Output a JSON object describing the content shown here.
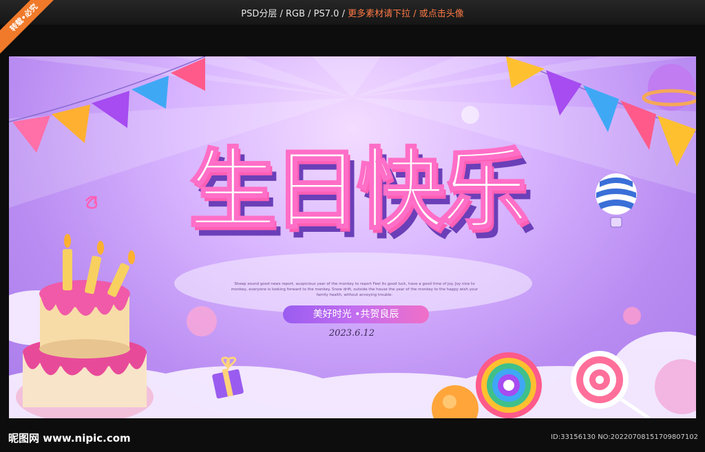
{
  "header": {
    "format_text": "PSD分层 / RGB / PS7.0 / ",
    "more_text": "更多素材请下拉 / 或点击头像"
  },
  "corner_badge": "转载•必究",
  "poster": {
    "title": "生日快乐",
    "blurb": "Sheep sound good news report, auspicious year of the monkey to report Feel its good luck, have a good time of joy. Joy nice to monkey, everyone is looking forward to the monkey. Snow drift, outside the house the year of the monkey to the happy wish your family health, without annoying trouble.",
    "slogan": "美好时光 •共贺良辰",
    "date": "2023.6.12"
  },
  "footer": {
    "logo": "昵图网 www.nipic.com",
    "id_text": "ID:33156130 NO:20220708151709807102"
  },
  "colors": {
    "bg_top": "#f3dcff",
    "bg_edge": "#a97ceb",
    "title_stroke": "#ff6ec7",
    "title_shadow": "#6a3fb8",
    "accent_orange": "#f07a2a"
  }
}
